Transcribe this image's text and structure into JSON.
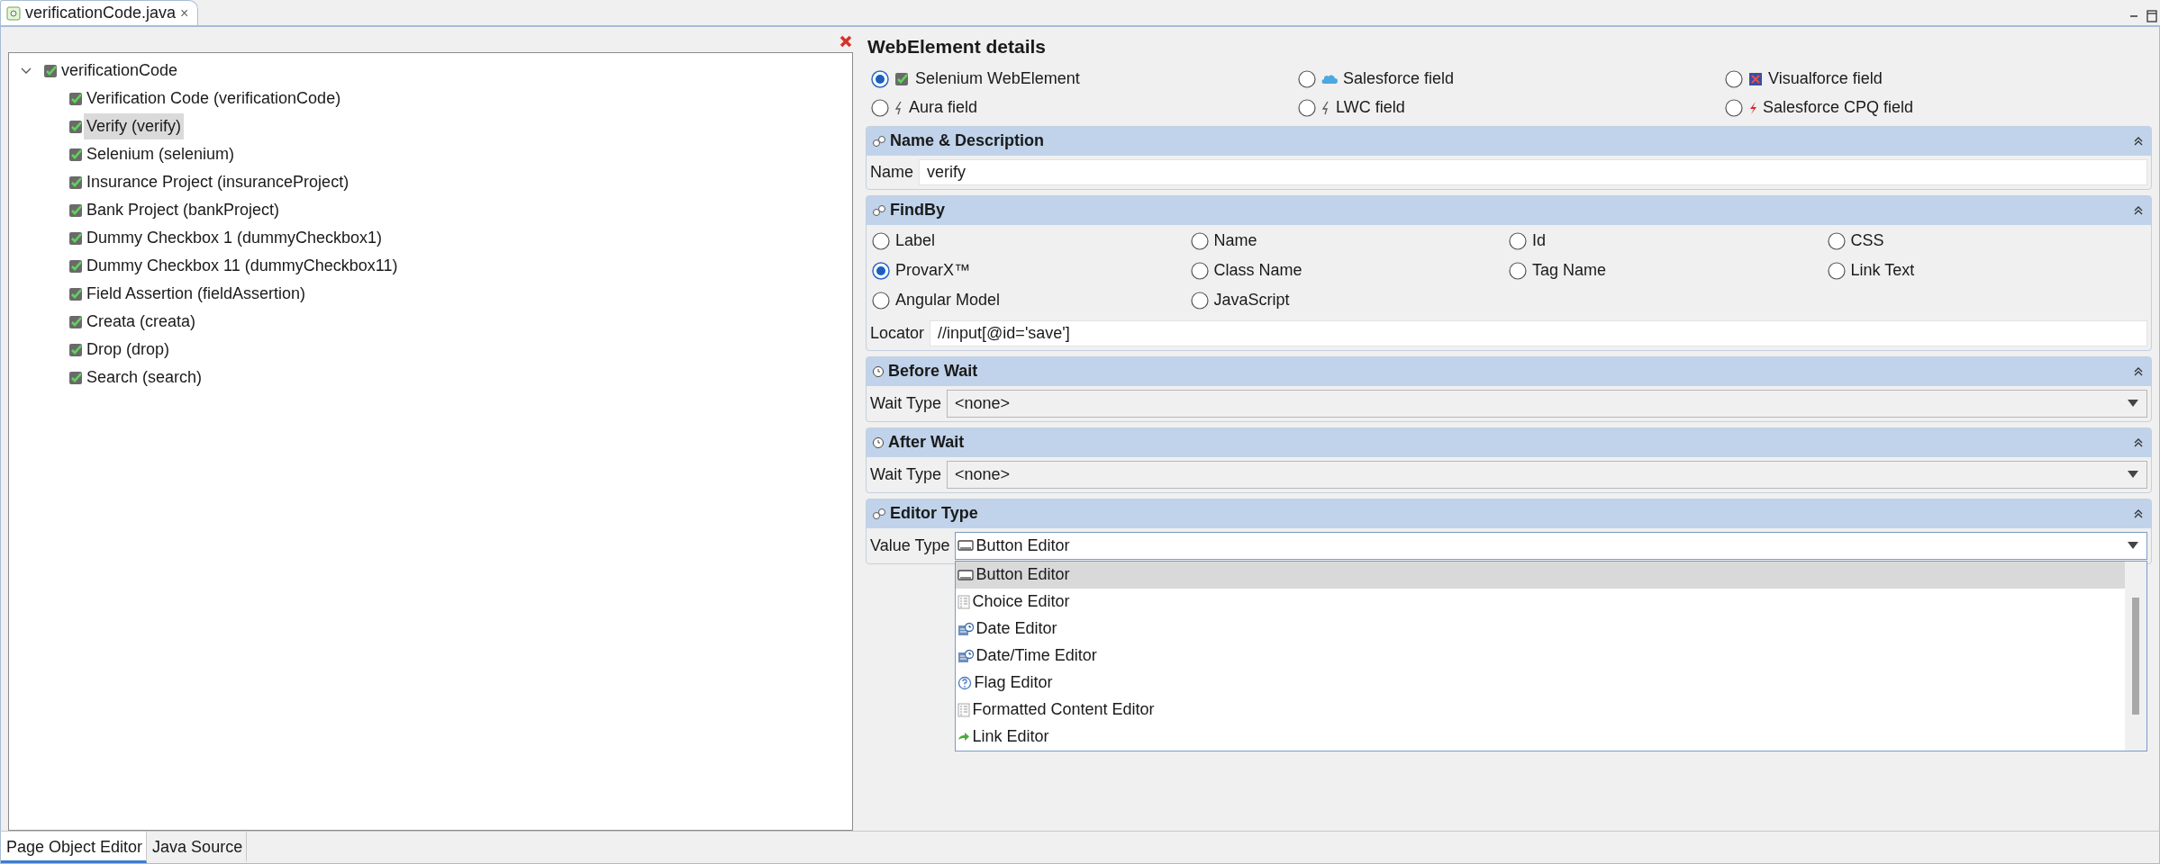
{
  "editor_tab": {
    "label": "verificationCode.java",
    "close": "×"
  },
  "tree": {
    "label": "verificationCode",
    "expanded": true,
    "children": [
      {
        "label": "Verification Code (verificationCode)",
        "selected": false
      },
      {
        "label": "Verify (verify)",
        "selected": true
      },
      {
        "label": "Selenium (selenium)",
        "selected": false
      },
      {
        "label": "Insurance Project (insuranceProject)",
        "selected": false
      },
      {
        "label": "Bank Project (bankProject)",
        "selected": false
      },
      {
        "label": "Dummy Checkbox 1 (dummyCheckbox1)",
        "selected": false
      },
      {
        "label": "Dummy Checkbox 11 (dummyCheckbox11)",
        "selected": false
      },
      {
        "label": "Field Assertion (fieldAssertion)",
        "selected": false
      },
      {
        "label": "Creata (creata)",
        "selected": false
      },
      {
        "label": "Drop (drop)",
        "selected": false
      },
      {
        "label": "Search (search)",
        "selected": false
      }
    ]
  },
  "details": {
    "title": "WebElement details",
    "element_types": [
      {
        "label": "Selenium WebElement",
        "selected": true,
        "kind": "selenium"
      },
      {
        "label": "Salesforce field",
        "selected": false,
        "kind": "cloud"
      },
      {
        "label": "Visualforce field",
        "selected": false,
        "kind": "visualforce"
      },
      {
        "label": "Aura field",
        "selected": false,
        "kind": "bolt"
      },
      {
        "label": "LWC field",
        "selected": false,
        "kind": "bolt"
      },
      {
        "label": "Salesforce CPQ field",
        "selected": false,
        "kind": "redbolt"
      }
    ]
  },
  "name_section": {
    "title": "Name & Description",
    "label": "Name",
    "value": "verify"
  },
  "findby": {
    "title": "FindBy",
    "options": [
      {
        "label": "Label",
        "selected": false
      },
      {
        "label": "Name",
        "selected": false
      },
      {
        "label": "Id",
        "selected": false
      },
      {
        "label": "CSS",
        "selected": false
      },
      {
        "label": "ProvarX™",
        "selected": true
      },
      {
        "label": "Class Name",
        "selected": false
      },
      {
        "label": "Tag Name",
        "selected": false
      },
      {
        "label": "Link Text",
        "selected": false
      },
      {
        "label": "Angular Model",
        "selected": false
      },
      {
        "label": "JavaScript",
        "selected": false
      }
    ],
    "locator_label": "Locator",
    "locator": "//input[@id='save']"
  },
  "before_wait": {
    "title": "Before Wait",
    "label": "Wait Type",
    "value": "<none>"
  },
  "after_wait": {
    "title": "After Wait",
    "label": "Wait Type",
    "value": "<none>"
  },
  "editor_type": {
    "title": "Editor Type",
    "label": "Value Type",
    "value": "Button Editor",
    "options": [
      {
        "label": "Button Editor",
        "selected": true,
        "kind": "button"
      },
      {
        "label": "Choice Editor",
        "selected": false,
        "kind": "list"
      },
      {
        "label": "Date Editor",
        "selected": false,
        "kind": "date"
      },
      {
        "label": "Date/Time Editor",
        "selected": false,
        "kind": "date"
      },
      {
        "label": "Flag Editor",
        "selected": false,
        "kind": "flag"
      },
      {
        "label": "Formatted Content Editor",
        "selected": false,
        "kind": "list"
      },
      {
        "label": "Link Editor",
        "selected": false,
        "kind": "link"
      }
    ]
  },
  "bottom_tabs": [
    {
      "label": "Page Object Editor",
      "selected": true
    },
    {
      "label": "Java Source",
      "selected": false
    }
  ]
}
